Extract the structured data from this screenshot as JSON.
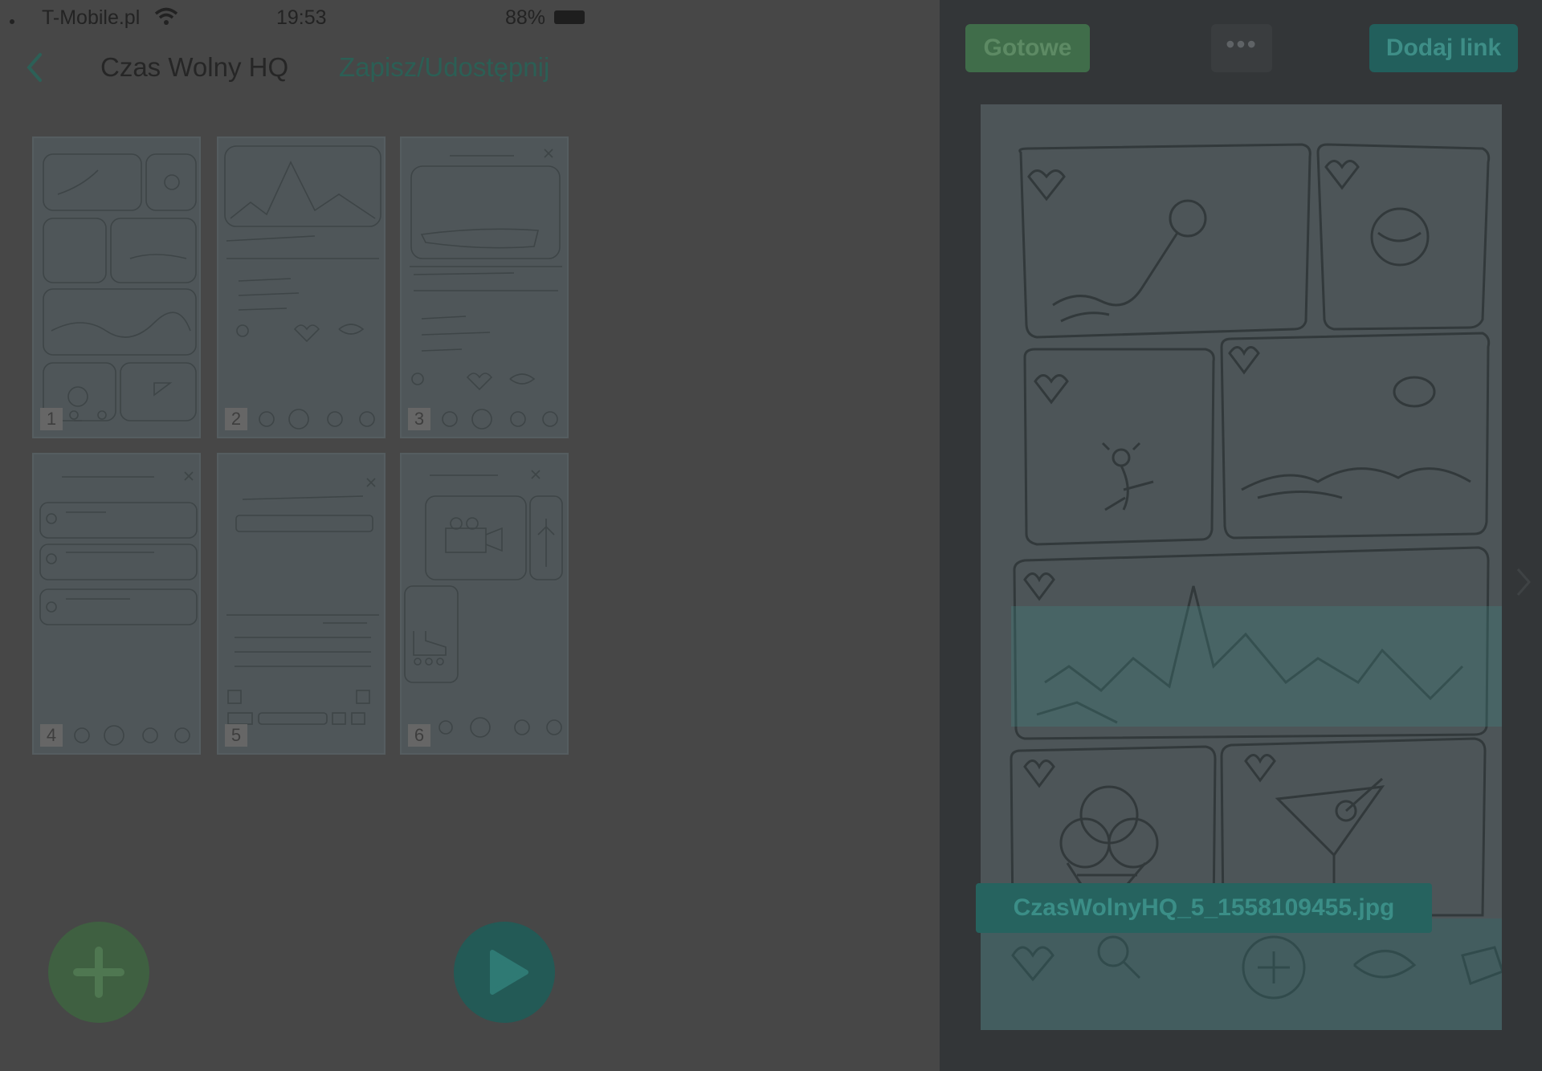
{
  "status_bar": {
    "carrier": "T-Mobile.pl",
    "time": "19:53",
    "battery": "88%"
  },
  "nav": {
    "back_icon": "chevron-left-icon",
    "title": "Czas Wolny HQ",
    "share_label": "Zapisz/Udostępnij"
  },
  "thumbnails": [
    {
      "number": "1"
    },
    {
      "number": "2"
    },
    {
      "number": "3"
    },
    {
      "number": "4"
    },
    {
      "number": "5"
    },
    {
      "number": "6"
    }
  ],
  "fab": {
    "add_icon": "plus-icon",
    "play_icon": "play-icon"
  },
  "preview_panel": {
    "done_label": "Gotowe",
    "more_label": "•••",
    "add_link_label": "Dodaj link",
    "filename": "CzasWolnyHQ_5_1558109455.jpg"
  },
  "colors": {
    "accent_green": "#406d4a",
    "accent_teal": "#225f5c",
    "overlay_dim": "#474747"
  }
}
